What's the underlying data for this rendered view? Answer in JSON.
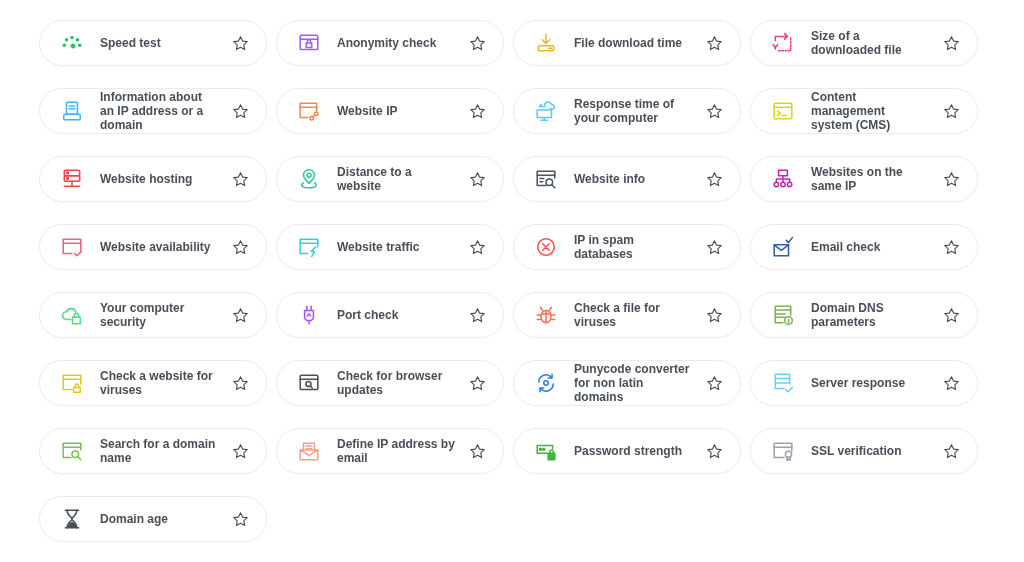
{
  "tools": [
    {
      "label": "Speed test",
      "kind": "gauge",
      "favorite": false
    },
    {
      "label": "Anonymity check",
      "kind": "browserlock",
      "favorite": false
    },
    {
      "label": "File download time",
      "kind": "download",
      "favorite": false
    },
    {
      "label": "Size of a downloaded file",
      "kind": "resize",
      "favorite": false
    },
    {
      "label": "Information about an IP address or a domain",
      "kind": "document",
      "favorite": false
    },
    {
      "label": "Website IP",
      "kind": "browserlink",
      "favorite": false
    },
    {
      "label": "Response time of your computer",
      "kind": "monitorcloud",
      "favorite": false
    },
    {
      "label": "Content management system (CMS)",
      "kind": "terminal",
      "favorite": false
    },
    {
      "label": "Website hosting",
      "kind": "server",
      "favorite": false
    },
    {
      "label": "Distance to a website",
      "kind": "pin",
      "favorite": false
    },
    {
      "label": "Website info",
      "kind": "browsersearch",
      "favorite": false
    },
    {
      "label": "Websites on the same IP",
      "kind": "sitemap",
      "favorite": false
    },
    {
      "label": "Website availability",
      "kind": "browsercheck",
      "favorite": false
    },
    {
      "label": "Website traffic",
      "kind": "browserbolt",
      "favorite": false
    },
    {
      "label": "IP in spam databases",
      "kind": "xcircle",
      "favorite": false
    },
    {
      "label": "Email check",
      "kind": "mailcheck",
      "favorite": false
    },
    {
      "label": "Your computer security",
      "kind": "cloudlock",
      "favorite": false
    },
    {
      "label": "Port check",
      "kind": "plug",
      "favorite": false
    },
    {
      "label": "Check a file for viruses",
      "kind": "bug",
      "favorite": false
    },
    {
      "label": "Domain DNS parameters",
      "kind": "serverinfo",
      "favorite": false
    },
    {
      "label": "Check a website for viruses",
      "kind": "browserlock2",
      "favorite": false
    },
    {
      "label": "Check for browser updates",
      "kind": "windowsearch",
      "favorite": false
    },
    {
      "label": "Punycode converter for non latin domains",
      "kind": "refresh",
      "favorite": false
    },
    {
      "label": "Server response",
      "kind": "servercheck",
      "favorite": false
    },
    {
      "label": "Search for a domain name",
      "kind": "browsersearch2",
      "favorite": false
    },
    {
      "label": "Define IP address by email",
      "kind": "mailopen",
      "favorite": false
    },
    {
      "label": "Password strength",
      "kind": "keylock",
      "favorite": false
    },
    {
      "label": "SSL verification",
      "kind": "browserbadge",
      "favorite": false
    },
    {
      "label": "Domain age",
      "kind": "hourglass",
      "favorite": false
    }
  ]
}
